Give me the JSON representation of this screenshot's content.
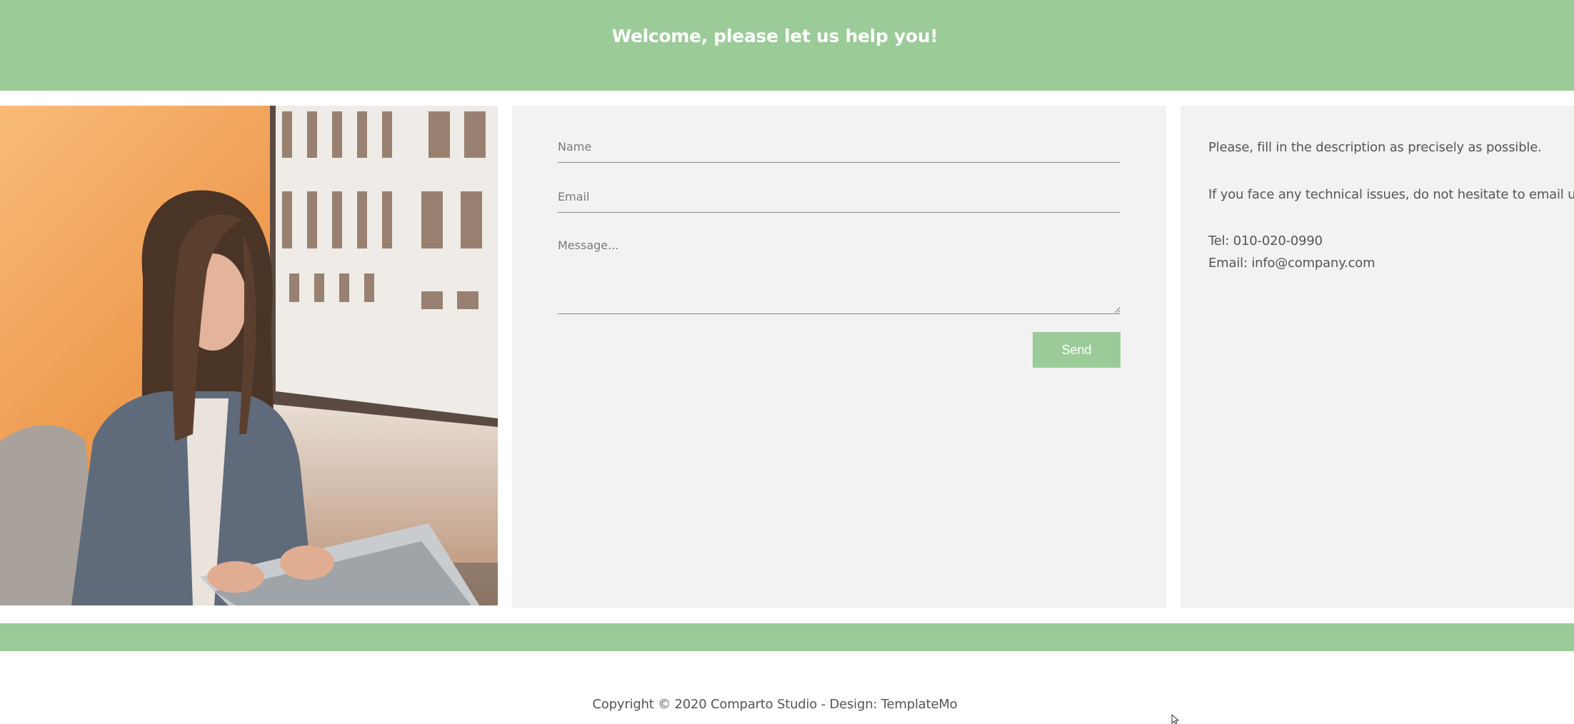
{
  "colors": {
    "accent": "#9bcb98",
    "panel": "#f2f2f2"
  },
  "header": {
    "title": "Welcome, please let us help you!"
  },
  "photo": {
    "icon": "woman-with-laptop-photo"
  },
  "form": {
    "name_placeholder": "Name",
    "email_placeholder": "Email",
    "message_placeholder": "Message...",
    "send_label": "Send"
  },
  "info": {
    "line1": "Please, fill in the description as precisely as possible.",
    "line2": "If you face any technical issues, do not hesitate to email us.",
    "tel": "Tel: 010-020-0990",
    "email": "Email: info@company.com"
  },
  "footer": {
    "copyright": "Copyright © 2020 Comparto Studio - Design: TemplateMo"
  }
}
